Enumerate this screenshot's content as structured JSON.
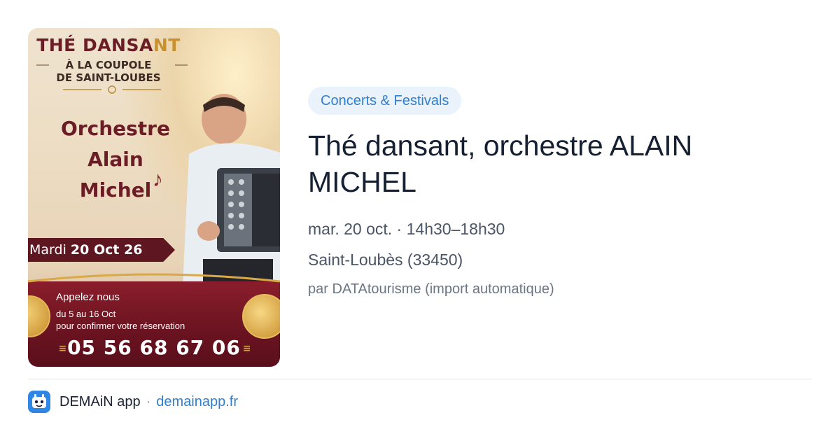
{
  "poster": {
    "title_main": "THÉ DANSA",
    "title_accent": "NT",
    "venue_line1": "À LA COUPOLE",
    "venue_line2": "DE SAINT-LOUBES",
    "band_line1": "Orchestre",
    "band_line2": "Alain",
    "band_line3": "Michel",
    "date_prefix": "Mardi",
    "date_value": "20 Oct 26",
    "call_title": "Appelez nous",
    "call_dates": "du 5 au 16 Oct",
    "call_note": "pour confirmer votre réservation",
    "phone": "05 56 68 67 06"
  },
  "event": {
    "category": "Concerts & Festivals",
    "title": "Thé dansant, orchestre ALAIN MICHEL",
    "datetime": "mar. 20 oct. · 14h30–18h30",
    "location": "Saint-Loubès (33450)",
    "source": "par DATAtourisme (import automatique)"
  },
  "footer": {
    "app_name": "DEMAiN app",
    "separator": "·",
    "domain": "demainapp.fr"
  },
  "colors": {
    "accent": "#2f7fd0",
    "tag_bg": "#eaf2fb",
    "poster_burgundy": "#6b1d26",
    "poster_gold": "#c9912e"
  }
}
